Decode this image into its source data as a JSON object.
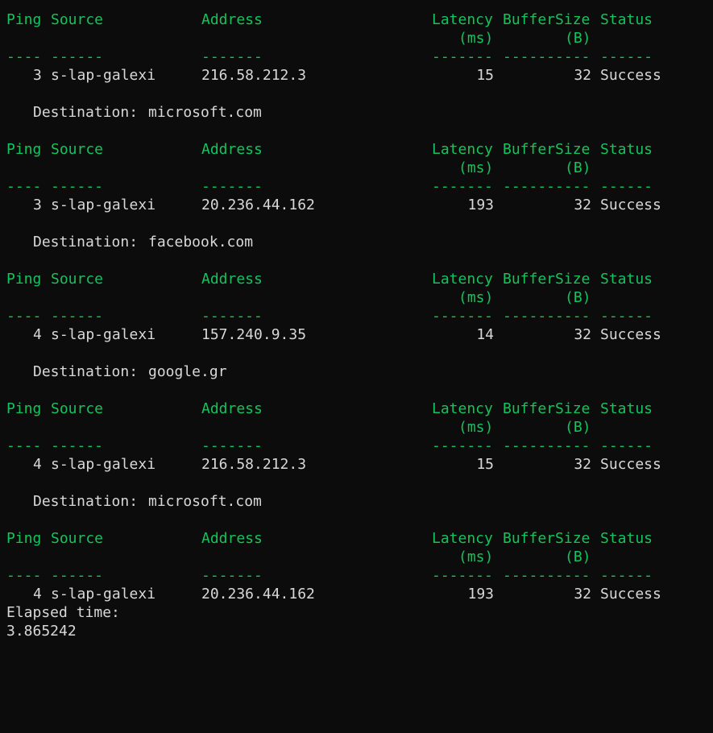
{
  "header": {
    "ping": "Ping",
    "source": "Source",
    "address": "Address",
    "latency": "Latency",
    "latency_unit": "(ms)",
    "buffer": "BufferSize",
    "buffer_unit": "(B)",
    "status": "Status",
    "sep_ping": "----",
    "sep_source": "------",
    "sep_address": "-------",
    "sep_latency": "-------",
    "sep_buffer": "----------",
    "sep_status": "------"
  },
  "rows": [
    {
      "ping": "3",
      "source": "s-lap-galexi",
      "address": "216.58.212.3",
      "latency": "15",
      "buffer": "32",
      "status": "Success",
      "destination_label": "Destination:",
      "destination": "microsoft.com"
    },
    {
      "ping": "3",
      "source": "s-lap-galexi",
      "address": "20.236.44.162",
      "latency": "193",
      "buffer": "32",
      "status": "Success",
      "destination_label": "Destination:",
      "destination": "facebook.com"
    },
    {
      "ping": "4",
      "source": "s-lap-galexi",
      "address": "157.240.9.35",
      "latency": "14",
      "buffer": "32",
      "status": "Success",
      "destination_label": "Destination:",
      "destination": "google.gr"
    },
    {
      "ping": "4",
      "source": "s-lap-galexi",
      "address": "216.58.212.3",
      "latency": "15",
      "buffer": "32",
      "status": "Success",
      "destination_label": "Destination:",
      "destination": "microsoft.com"
    },
    {
      "ping": "4",
      "source": "s-lap-galexi",
      "address": "20.236.44.162",
      "latency": "193",
      "buffer": "32",
      "status": "Success"
    }
  ],
  "footer": {
    "elapsed_label": "Elapsed time:",
    "elapsed_value": "3.865242"
  },
  "colors": {
    "background": "#0c0c0c",
    "header": "#13c35c",
    "text": "#d8d8d8"
  }
}
